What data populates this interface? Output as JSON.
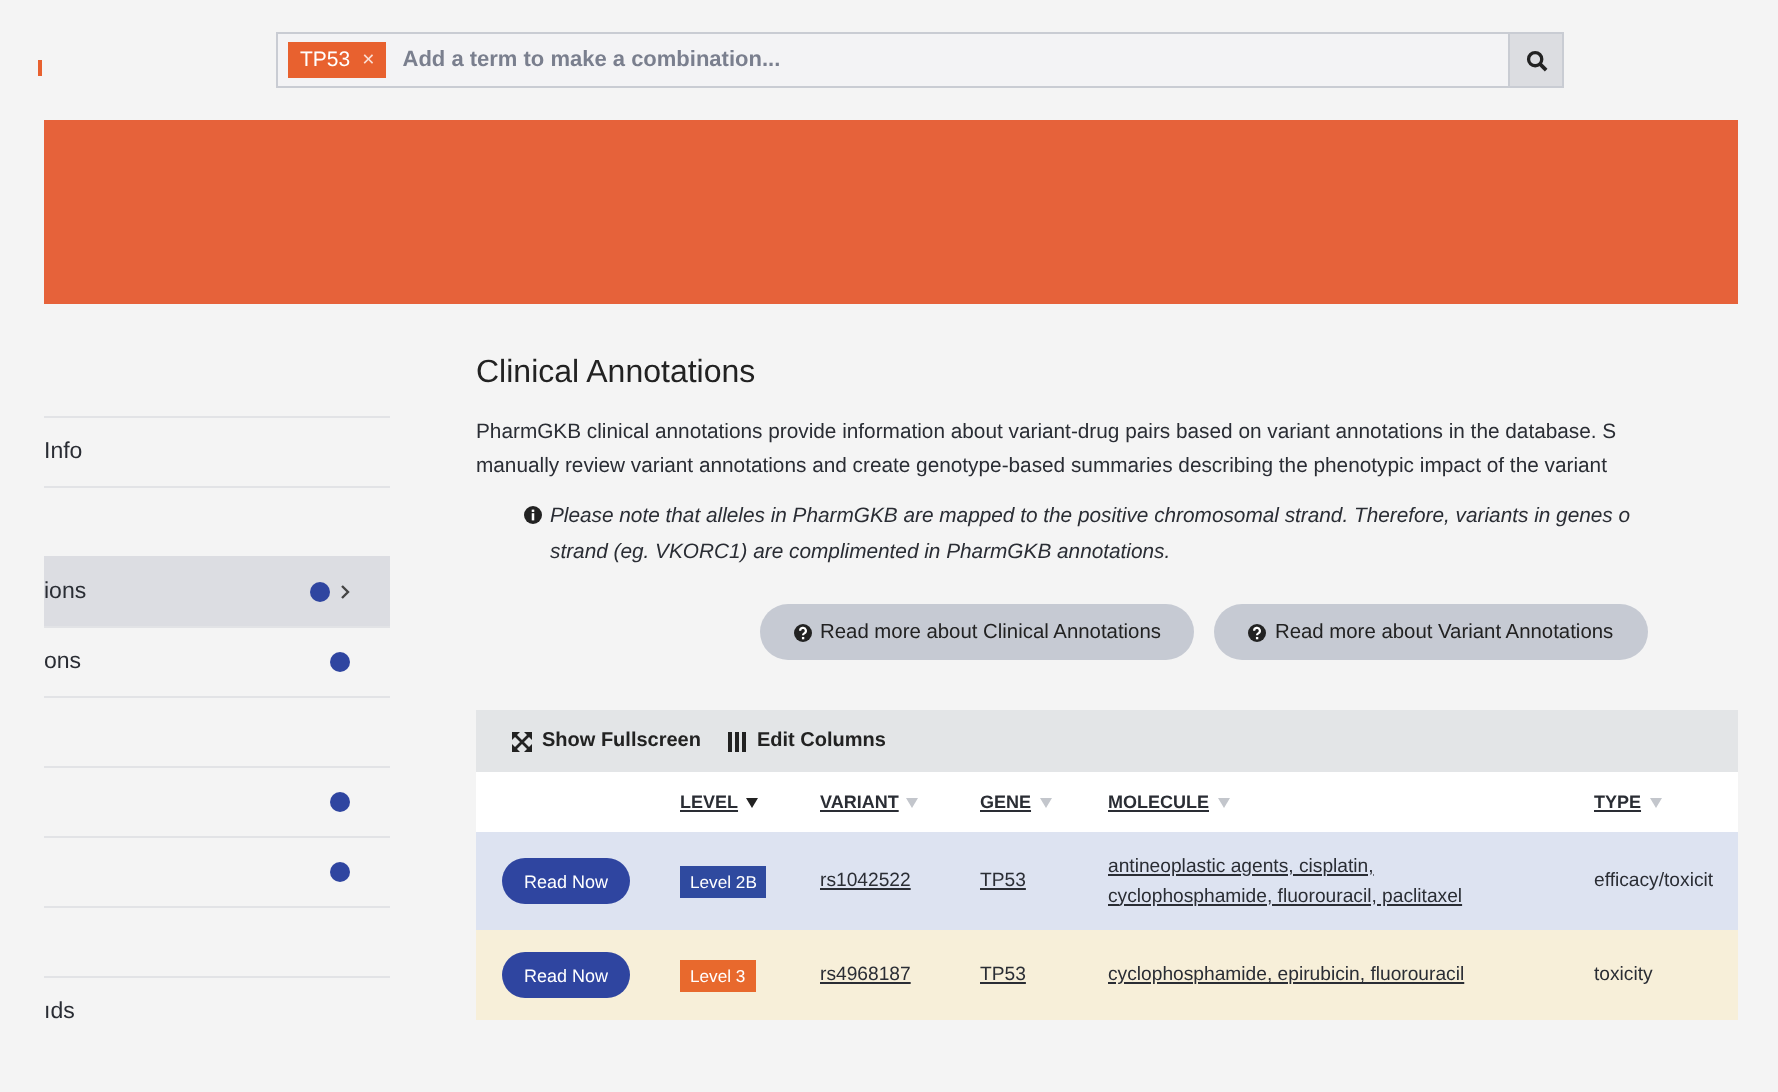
{
  "search": {
    "tags": [
      {
        "label": "TP53",
        "remove": "×"
      }
    ],
    "placeholder": "Add a term to make a combination..."
  },
  "sidebar": {
    "items": [
      {
        "label": "Info",
        "dot": false,
        "selected": false
      },
      {
        "dot": false,
        "selected": false
      },
      {
        "label": "ions",
        "dot": true,
        "selected": true
      },
      {
        "label": "ons",
        "dot": true,
        "selected": false
      },
      {
        "dot": false,
        "selected": false
      },
      {
        "dot": true,
        "selected": false
      },
      {
        "dot": true,
        "selected": false
      },
      {
        "dot": false,
        "selected": false
      },
      {
        "label": "ıds",
        "dot": false,
        "selected": false
      }
    ]
  },
  "main": {
    "title": "Clinical Annotations",
    "paragraph_lines": [
      "PharmGKB clinical annotations provide information about variant-drug pairs based on variant annotations in the database. S",
      "manually review variant annotations and create genotype-based summaries describing the phenotypic impact of the variant"
    ],
    "note_lines": [
      "Please note that alleles in PharmGKB are mapped to the positive chromosomal strand. Therefore, variants in genes o",
      "strand (eg. VKORC1) are complimented in PharmGKB annotations."
    ],
    "buttons": [
      "Read more about Clinical Annotations",
      "Read more about Variant Annotations"
    ]
  },
  "table": {
    "toolbar": [
      "Show Fullscreen",
      "Edit Columns"
    ],
    "columns": [
      {
        "label": "LEVEL",
        "sorted": true
      },
      {
        "label": "VARIANT",
        "sorted": false
      },
      {
        "label": "GENE",
        "sorted": false
      },
      {
        "label": "MOLECULE",
        "sorted": false
      },
      {
        "label": "TYPE",
        "sorted": false
      }
    ],
    "rows": [
      {
        "color": "#dde3f1",
        "action": "Read Now",
        "level": {
          "text": "Level 2B",
          "color": "#2f4a9f"
        },
        "variant": "rs1042522",
        "gene": "TP53",
        "molecule": "antineoplastic agents, cisplatin, cyclophosphamide, fluorouracil, paclitaxel",
        "type": "efficacy/toxicit"
      },
      {
        "color": "#f7efd9",
        "action": "Read Now",
        "level": {
          "text": "Level 3",
          "color": "#e8692d"
        },
        "variant": "rs4968187",
        "gene": "TP53",
        "molecule": "cyclophosphamide, epirubicin, fluorouracil",
        "type": "toxicity"
      }
    ]
  }
}
